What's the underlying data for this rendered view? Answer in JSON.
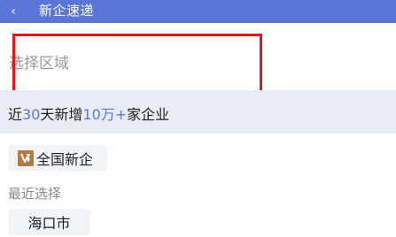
{
  "header": {
    "title": "新企速递",
    "back_icon": "chevron-left-icon",
    "back_glyph": "‹",
    "background": "#5b74d8"
  },
  "select_area": {
    "placeholder": "选择区域",
    "highlight_color": "#e3141c"
  },
  "stats": {
    "prefix": "近",
    "days": "30",
    "middle": "天新增",
    "count": "10万+",
    "suffix": "家企业",
    "accent_color": "#5d76e2"
  },
  "national_chip": {
    "icon": "brand-logo-icon",
    "label": "全国新企"
  },
  "recent": {
    "label": "最近选择",
    "items": [
      "海口市"
    ]
  }
}
